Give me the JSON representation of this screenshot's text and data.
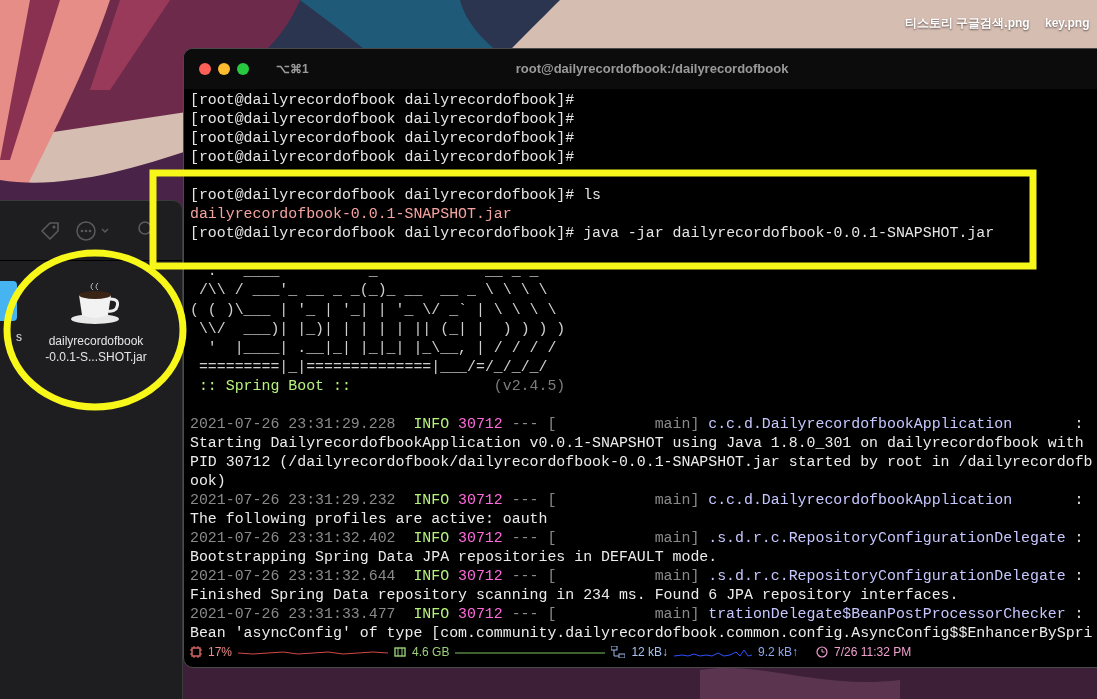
{
  "desktop": {
    "files": [
      {
        "name": "티스토리 구글검색.png"
      },
      {
        "name": "key.png"
      }
    ]
  },
  "finder": {
    "items": [
      {
        "kind": "folder",
        "label_lines": [
          "s"
        ]
      },
      {
        "kind": "jar",
        "label_lines": [
          "dailyrecordofbook",
          "-0.0.1-S...SHOT.jar"
        ]
      }
    ]
  },
  "terminal": {
    "shortcut": "⌥⌘1",
    "title": "root@dailyrecordofbook:/dailyrecordofbook",
    "lines": [
      {
        "kind": "prompt",
        "text": "[root@dailyrecordofbook dailyrecordofbook]#"
      },
      {
        "kind": "prompt",
        "text": "[root@dailyrecordofbook dailyrecordofbook]#"
      },
      {
        "kind": "prompt",
        "text": "[root@dailyrecordofbook dailyrecordofbook]#"
      },
      {
        "kind": "prompt",
        "text": "[root@dailyrecordofbook dailyrecordofbook]#"
      },
      {
        "kind": "blank"
      },
      {
        "kind": "prompt",
        "text": "[root@dailyrecordofbook dailyrecordofbook]# ls"
      },
      {
        "kind": "file",
        "text": "dailyrecordofbook-0.0.1-SNAPSHOT.jar"
      },
      {
        "kind": "prompt",
        "text": "[root@dailyrecordofbook dailyrecordofbook]# java -jar dailyrecordofbook-0.0.1-SNAPSHOT.jar"
      },
      {
        "kind": "blank"
      },
      {
        "kind": "banner",
        "text": "  .   ____          _            __ _ _"
      },
      {
        "kind": "banner",
        "text": " /\\\\ / ___'_ __ _ _(_)_ __  __ _ \\ \\ \\ \\"
      },
      {
        "kind": "banner",
        "text": "( ( )\\___ | '_ | '_| | '_ \\/ _` | \\ \\ \\ \\"
      },
      {
        "kind": "banner",
        "text": " \\\\/  ___)| |_)| | | | | || (_| |  ) ) ) )"
      },
      {
        "kind": "banner",
        "text": "  '  |____| .__|_| |_|_| |_\\__, | / / / /"
      },
      {
        "kind": "banner",
        "text": " =========|_|==============|___/=/_/_/_/"
      },
      {
        "kind": "banner_title",
        "segments": [
          {
            "kind": "label",
            "text": ":: Spring Boot ::"
          },
          {
            "kind": "version",
            "text": "(v2.4.5)"
          }
        ]
      },
      {
        "kind": "blank"
      },
      {
        "kind": "log",
        "segments": [
          {
            "kind": "time",
            "text": "2021-07-26 23:31:29.228"
          },
          {
            "kind": "level",
            "text": "INFO"
          },
          {
            "kind": "pid",
            "text": "30712"
          },
          {
            "kind": "separator",
            "text": "--- ["
          },
          {
            "kind": "thread",
            "text": "main]"
          },
          {
            "kind": "logger",
            "text": "c.c.d.DailyrecordofbookApplication"
          },
          {
            "kind": "colon",
            "text": ":"
          }
        ]
      },
      {
        "kind": "message",
        "text": "Starting DailyrecordofbookApplication v0.0.1-SNAPSHOT using Java 1.8.0_301 on dailyrecordofbook with"
      },
      {
        "kind": "message",
        "text": "PID 30712 (/dailyrecordofbook/dailyrecordofbook-0.0.1-SNAPSHOT.jar started by root in /dailyrecordofb"
      },
      {
        "kind": "message",
        "text": "ook)"
      },
      {
        "kind": "log",
        "segments": [
          {
            "kind": "time",
            "text": "2021-07-26 23:31:29.232"
          },
          {
            "kind": "level",
            "text": "INFO"
          },
          {
            "kind": "pid",
            "text": "30712"
          },
          {
            "kind": "separator",
            "text": "--- ["
          },
          {
            "kind": "thread",
            "text": "main]"
          },
          {
            "kind": "logger",
            "text": "c.c.d.DailyrecordofbookApplication"
          },
          {
            "kind": "colon",
            "text": ":"
          }
        ]
      },
      {
        "kind": "message",
        "text": "The following profiles are active: oauth"
      },
      {
        "kind": "log",
        "segments": [
          {
            "kind": "time",
            "text": "2021-07-26 23:31:32.402"
          },
          {
            "kind": "level",
            "text": "INFO"
          },
          {
            "kind": "pid",
            "text": "30712"
          },
          {
            "kind": "separator",
            "text": "--- ["
          },
          {
            "kind": "thread",
            "text": "main]"
          },
          {
            "kind": "logger",
            "text": ".s.d.r.c.RepositoryConfigurationDelegate"
          },
          {
            "kind": "colon",
            "text": ":"
          }
        ]
      },
      {
        "kind": "message",
        "text": "Bootstrapping Spring Data JPA repositories in DEFAULT mode."
      },
      {
        "kind": "log",
        "segments": [
          {
            "kind": "time",
            "text": "2021-07-26 23:31:32.644"
          },
          {
            "kind": "level",
            "text": "INFO"
          },
          {
            "kind": "pid",
            "text": "30712"
          },
          {
            "kind": "separator",
            "text": "--- ["
          },
          {
            "kind": "thread",
            "text": "main]"
          },
          {
            "kind": "logger",
            "text": ".s.d.r.c.RepositoryConfigurationDelegate"
          },
          {
            "kind": "colon",
            "text": ":"
          }
        ]
      },
      {
        "kind": "message",
        "text": "Finished Spring Data repository scanning in 234 ms. Found 6 JPA repository interfaces."
      },
      {
        "kind": "log",
        "segments": [
          {
            "kind": "time",
            "text": "2021-07-26 23:31:33.477"
          },
          {
            "kind": "level",
            "text": "INFO"
          },
          {
            "kind": "pid",
            "text": "30712"
          },
          {
            "kind": "separator",
            "text": "--- ["
          },
          {
            "kind": "thread",
            "text": "main]"
          },
          {
            "kind": "logger",
            "text": "trationDelegate$BeanPostProcessorChecker"
          },
          {
            "kind": "colon",
            "text": ":"
          }
        ]
      },
      {
        "kind": "message",
        "text": "Bean 'asyncConfig' of type [com.community.dailyrecordofbook.common.config.AsyncConfig$$EnhancerBySpri"
      }
    ],
    "status_bar": {
      "cpu": "17%",
      "memory": "4.6 GB",
      "download": "12 kB↓",
      "upload": "9.2 kB↑",
      "time": "7/26 11:32 PM"
    }
  },
  "annotations": [
    {
      "kind": "rectangle"
    },
    {
      "kind": "ellipse"
    }
  ]
}
